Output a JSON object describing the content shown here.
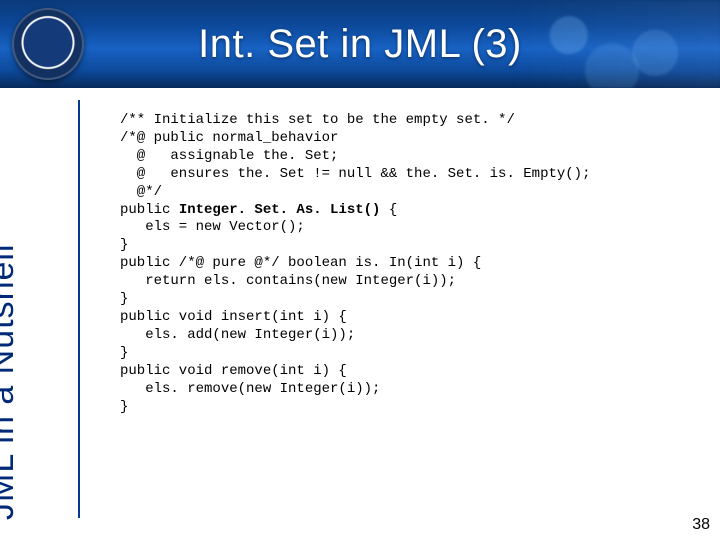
{
  "slide": {
    "title": "Int. Set in JML (3)",
    "sidebar_label": "JML in a Nutshell",
    "page_number": "38",
    "logo": {
      "name": "polimi-seal"
    },
    "code": {
      "lines": [
        {
          "text": "/** Initialize this set to be the empty set. */",
          "bold_segments": []
        },
        {
          "text": "/*@ public normal_behavior",
          "bold_segments": []
        },
        {
          "text": "  @   assignable the. Set;",
          "bold_segments": []
        },
        {
          "text": "  @   ensures the. Set != null && the. Set. is. Empty();",
          "bold_segments": []
        },
        {
          "text": "  @*/",
          "bold_segments": []
        },
        {
          "text": "public Integer. Set. As. List() {",
          "bold_segments": [
            "Integer. Set. As. List()"
          ]
        },
        {
          "text": "   els = new Vector();",
          "bold_segments": []
        },
        {
          "text": "}",
          "bold_segments": []
        },
        {
          "text": "public /*@ pure @*/ boolean is. In(int i) {",
          "bold_segments": []
        },
        {
          "text": "   return els. contains(new Integer(i));",
          "bold_segments": []
        },
        {
          "text": "}",
          "bold_segments": []
        },
        {
          "text": "public void insert(int i) {",
          "bold_segments": []
        },
        {
          "text": "   els. add(new Integer(i));",
          "bold_segments": []
        },
        {
          "text": "}",
          "bold_segments": []
        },
        {
          "text": "public void remove(int i) {",
          "bold_segments": []
        },
        {
          "text": "   els. remove(new Integer(i));",
          "bold_segments": []
        },
        {
          "text": "}",
          "bold_segments": []
        }
      ]
    }
  }
}
